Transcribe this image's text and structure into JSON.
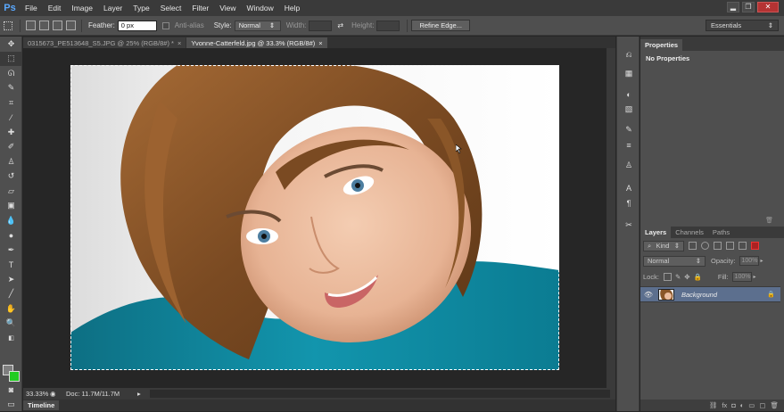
{
  "app": {
    "logo": "Ps"
  },
  "menu": [
    {
      "label": "File"
    },
    {
      "label": "Edit"
    },
    {
      "label": "Image"
    },
    {
      "label": "Layer"
    },
    {
      "label": "Type"
    },
    {
      "label": "Select"
    },
    {
      "label": "Filter"
    },
    {
      "label": "View"
    },
    {
      "label": "Window"
    },
    {
      "label": "Help"
    }
  ],
  "window_buttons": {
    "minimize": "▂",
    "restore": "❐",
    "close": "✕"
  },
  "options": {
    "feather_label": "Feather:",
    "feather_value": "0 px",
    "antialias_label": "Anti-alias",
    "style_label": "Style:",
    "style_value": "Normal",
    "width_label": "Width:",
    "height_label": "Height:",
    "refine_label": "Refine Edge...",
    "workspace": "Essentials"
  },
  "tabs": [
    {
      "label": "0315673_PE513648_S5.JPG @ 25% (RGB/8#) *",
      "close": "×"
    },
    {
      "label": "Yvonne-Catterfeld.jpg @ 33.3% (RGB/8#)",
      "close": "×"
    }
  ],
  "status": {
    "zoom": "33.33%",
    "doc": "Doc: 11.7M/11.7M"
  },
  "timeline": {
    "label": "Timeline"
  },
  "properties": {
    "tab": "Properties",
    "empty_text": "No Properties"
  },
  "layers": {
    "tabs": [
      "Layers",
      "Channels",
      "Paths"
    ],
    "filter_kind": "Kind",
    "blend_mode": "Normal",
    "opacity_label": "Opacity:",
    "opacity_value": "100%",
    "lock_label": "Lock:",
    "fill_label": "Fill:",
    "fill_value": "100%",
    "items": [
      {
        "name": "Background",
        "locked": true,
        "visible": true
      }
    ]
  },
  "colors": {
    "foreground": "#7f7f7f",
    "background": "#22cc22",
    "layer_selected": "#5c6f8e",
    "logo": "#5aa9ff"
  },
  "tools": [
    "move-tool",
    "marquee-tool",
    "lasso-tool",
    "quick-select-tool",
    "crop-tool",
    "eyedropper-tool",
    "healing-brush-tool",
    "brush-tool",
    "clone-stamp-tool",
    "history-brush-tool",
    "eraser-tool",
    "gradient-tool",
    "blur-tool",
    "dodge-tool",
    "pen-tool",
    "type-tool",
    "path-select-tool",
    "shape-tool",
    "hand-tool",
    "zoom-tool"
  ]
}
